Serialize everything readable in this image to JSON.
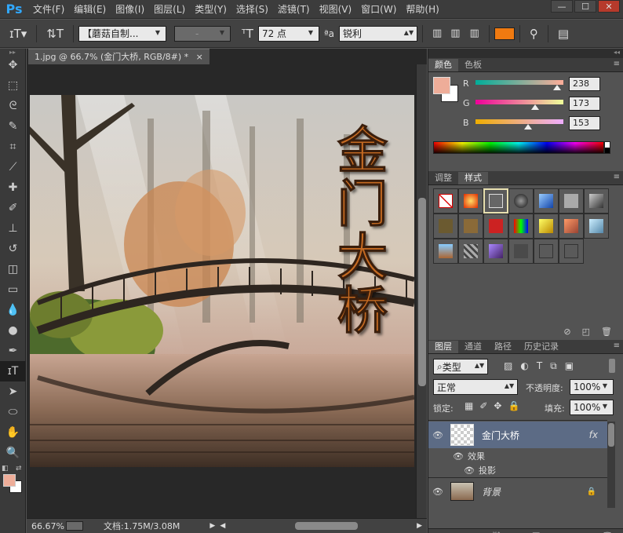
{
  "app": {
    "logo": "Ps",
    "menu": [
      "文件(F)",
      "编辑(E)",
      "图像(I)",
      "图层(L)",
      "类型(Y)",
      "选择(S)",
      "滤镜(T)",
      "视图(V)",
      "窗口(W)",
      "帮助(H)"
    ],
    "window_controls": [
      "minimize",
      "maximize",
      "close"
    ]
  },
  "options_bar": {
    "font_family": "【蘑菇自制...",
    "font_style": "-",
    "font_size": "72 点",
    "aa_label": "ªa",
    "anti_alias": "锐利",
    "text_color": "#f07a10"
  },
  "document": {
    "tab_title": "1.jpg @ 66.7% (金门大桥, RGB/8#) *",
    "text_chars": [
      "金",
      "门",
      "大",
      "桥"
    ],
    "zoom": "66.67%",
    "doc_info": "文档:1.75M/3.08M"
  },
  "color_panel": {
    "tabs": [
      "颜色",
      "色板"
    ],
    "active_tab": "颜色",
    "foreground": "#eeAD99",
    "background": "#ffffff",
    "channels": [
      {
        "label": "R",
        "value": "238",
        "fraction": 0.933
      },
      {
        "label": "G",
        "value": "173",
        "fraction": 0.678
      },
      {
        "label": "B",
        "value": "153",
        "fraction": 0.6
      }
    ]
  },
  "styles_panel": {
    "tabs": [
      "调整",
      "样式"
    ],
    "active_tab": "样式"
  },
  "layers_panel": {
    "tabs": [
      "图层",
      "通道",
      "路径",
      "历史记录"
    ],
    "active_tab": "图层",
    "filter_kind": "类型",
    "blend_mode": "正常",
    "opacity_label": "不透明度:",
    "opacity": "100%",
    "lock_label": "锁定:",
    "fill_label": "填充:",
    "fill": "100%",
    "layers": [
      {
        "name": "金门大桥",
        "fx": "fx",
        "selected": true
      },
      {
        "name": "效果",
        "indent": 1
      },
      {
        "name": "投影",
        "indent": 2
      },
      {
        "name": "背景",
        "locked": true
      }
    ]
  },
  "tools": [
    "move-tool",
    "marquee-tool",
    "lasso-tool",
    "quick-select-tool",
    "crop-tool",
    "eyedropper-tool",
    "healing-tool",
    "brush-tool",
    "stamp-tool",
    "history-brush-tool",
    "eraser-tool",
    "gradient-tool",
    "blur-tool",
    "dodge-tool",
    "pen-tool",
    "type-tool",
    "path-select-tool",
    "shape-tool",
    "hand-tool",
    "zoom-tool"
  ],
  "toolbar_colors": {
    "foreground": "#eeAD99",
    "background": "#ffffff"
  }
}
